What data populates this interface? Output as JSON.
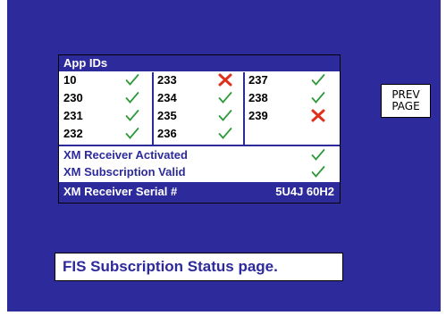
{
  "colors": {
    "screen_bg": "#2d2a9b",
    "check": "#2e9a3a",
    "cross": "#e0301e"
  },
  "panel": {
    "header": "App IDs",
    "apps": [
      {
        "id": "10",
        "status": "ok"
      },
      {
        "id": "230",
        "status": "ok"
      },
      {
        "id": "231",
        "status": "ok"
      },
      {
        "id": "232",
        "status": "ok"
      },
      {
        "id": "233",
        "status": "fail"
      },
      {
        "id": "234",
        "status": "ok"
      },
      {
        "id": "235",
        "status": "ok"
      },
      {
        "id": "236",
        "status": "ok"
      },
      {
        "id": "237",
        "status": "ok"
      },
      {
        "id": "238",
        "status": "ok"
      },
      {
        "id": "239",
        "status": "fail"
      }
    ],
    "status_rows": [
      {
        "label": "XM Receiver Activated",
        "status": "ok"
      },
      {
        "label": "XM Subscription Valid",
        "status": "ok"
      }
    ],
    "serial": {
      "label": "XM Receiver Serial #",
      "value": "5U4J 60H2"
    }
  },
  "buttons": {
    "prev_page_line1": "PREV",
    "prev_page_line2": "PAGE"
  },
  "footer": {
    "message": "FIS Subscription Status page."
  }
}
